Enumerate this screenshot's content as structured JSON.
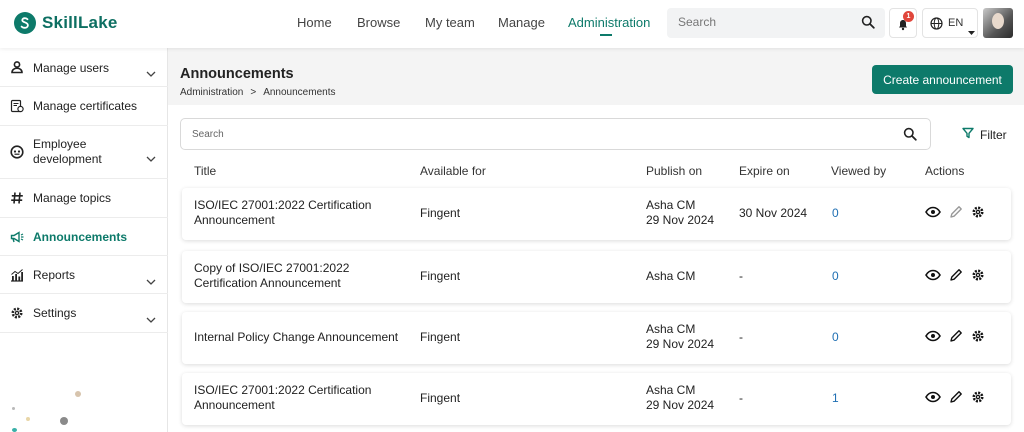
{
  "brand": {
    "name": "SkillLake",
    "accent": "#0d7a6a"
  },
  "nav": {
    "items": [
      {
        "label": "Home"
      },
      {
        "label": "Browse"
      },
      {
        "label": "My team"
      },
      {
        "label": "Manage"
      },
      {
        "label": "Administration",
        "active": true
      }
    ],
    "search_placeholder": "Search",
    "notifications_count": "1",
    "language": "EN"
  },
  "sidebar": {
    "items": [
      {
        "label": "Manage users",
        "icon": "person-icon",
        "expandable": true
      },
      {
        "label": "Manage certificates",
        "icon": "certificate-icon",
        "expandable": false
      },
      {
        "label": "Employee development",
        "icon": "development-icon",
        "expandable": true
      },
      {
        "label": "Manage topics",
        "icon": "hash-icon",
        "expandable": false
      },
      {
        "label": "Announcements",
        "icon": "megaphone-icon",
        "expandable": false,
        "active": true
      },
      {
        "label": "Reports",
        "icon": "bar-chart-icon",
        "expandable": true
      },
      {
        "label": "Settings",
        "icon": "gear-icon",
        "expandable": true
      }
    ]
  },
  "page": {
    "title": "Announcements",
    "breadcrumb": [
      "Administration",
      ">",
      "Announcements"
    ],
    "create_button": "Create announcement",
    "search_placeholder": "Search",
    "filter_label": "Filter"
  },
  "table": {
    "columns": [
      "Title",
      "Available for",
      "Publish on",
      "Expire on",
      "Viewed by",
      "Actions"
    ],
    "rows": [
      {
        "title_1": "ISO/IEC 27001:2022 Certification",
        "title_2": "Announcement",
        "available_for": "Fingent",
        "publisher": "Asha CM",
        "publish_date": "29 Nov 2024",
        "expire_on": "30 Nov 2024",
        "viewed_by": "0"
      },
      {
        "title_1": "Copy of ISO/IEC 27001:2022",
        "title_2": "Certification Announcement",
        "available_for": "Fingent",
        "publisher": "Asha CM",
        "publish_date": "",
        "expire_on": "-",
        "viewed_by": "0"
      },
      {
        "title_1": "Internal Policy Change Announcement",
        "title_2": "",
        "available_for": "Fingent",
        "publisher": "Asha CM",
        "publish_date": "29 Nov 2024",
        "expire_on": "-",
        "viewed_by": "0"
      },
      {
        "title_1": "ISO/IEC 27001:2022 Certification",
        "title_2": "Announcement",
        "available_for": "Fingent",
        "publisher": "Asha CM",
        "publish_date": "29 Nov 2024",
        "expire_on": "-",
        "viewed_by": "1"
      }
    ]
  }
}
